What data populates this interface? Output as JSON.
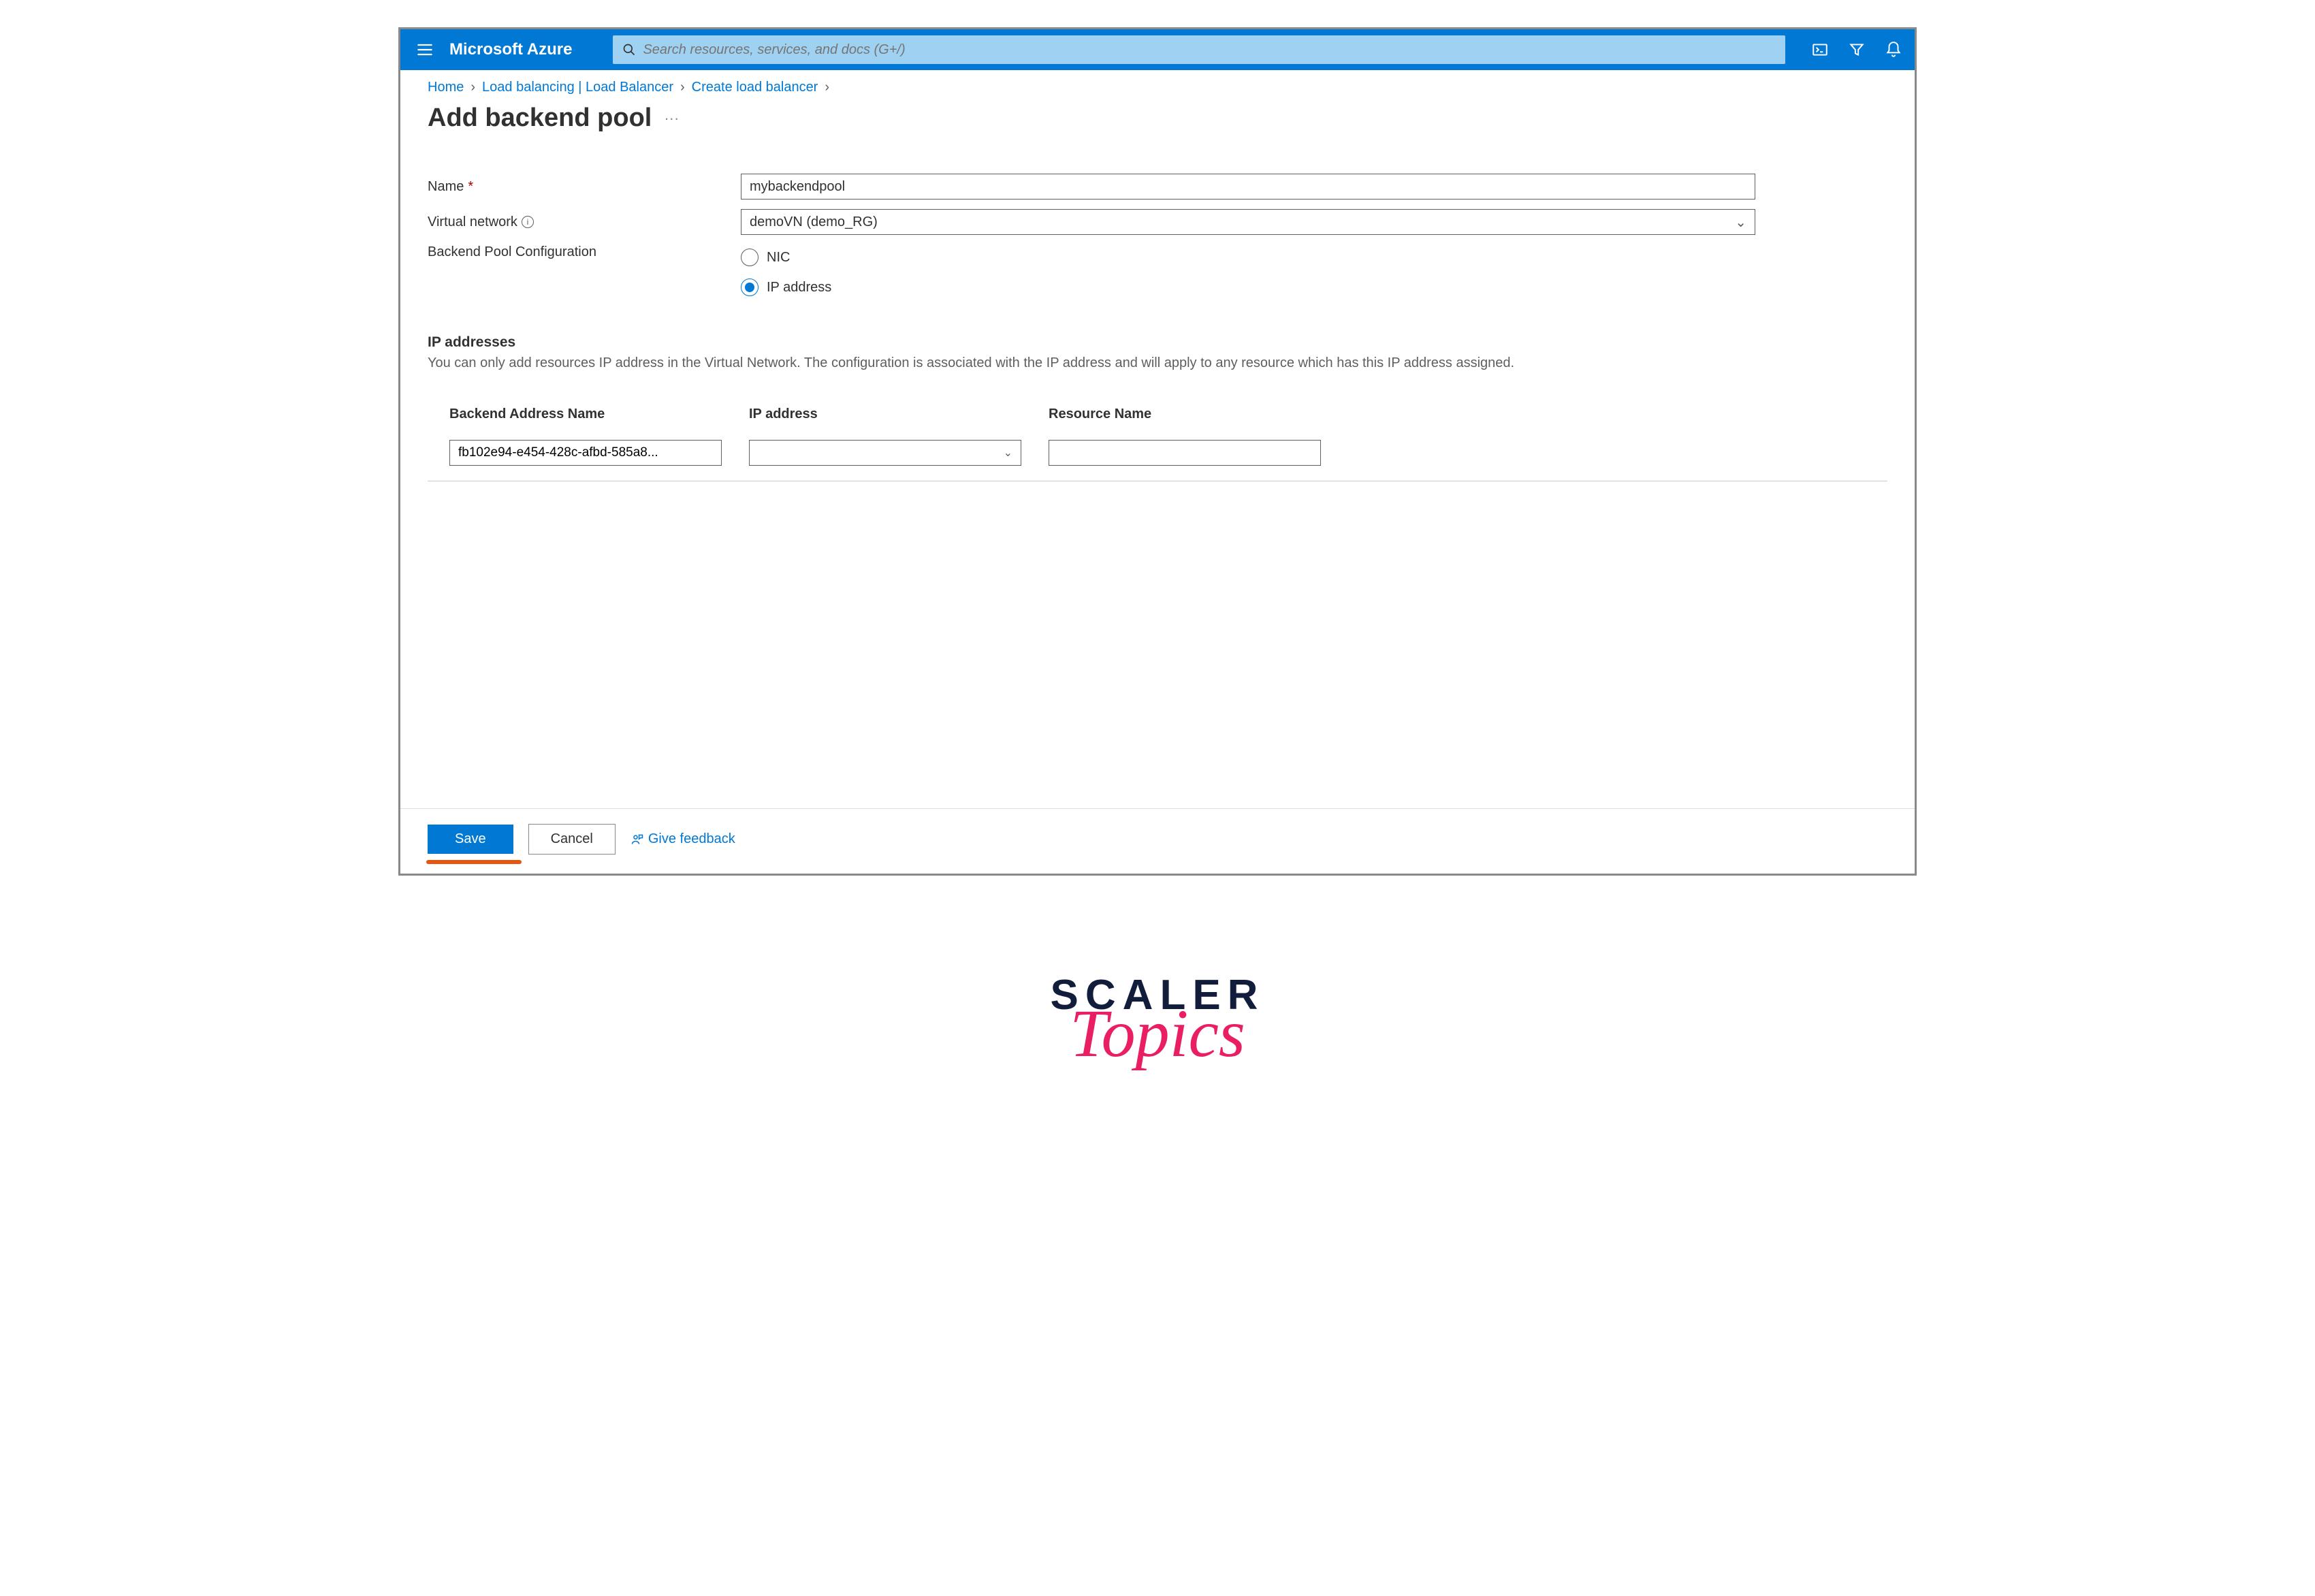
{
  "header": {
    "brand": "Microsoft Azure",
    "search_placeholder": "Search resources, services, and docs (G+/)"
  },
  "breadcrumbs": {
    "home": "Home",
    "lb_list": "Load balancing | Load Balancer",
    "create": "Create load balancer"
  },
  "page": {
    "title": "Add backend pool"
  },
  "form": {
    "name_label": "Name",
    "name_value": "mybackendpool",
    "vnet_label": "Virtual network",
    "vnet_value": "demoVN (demo_RG)",
    "config_label": "Backend Pool Configuration",
    "radio_nic": "NIC",
    "radio_ip": "IP address"
  },
  "ip_section": {
    "title": "IP addresses",
    "desc": "You can only add resources IP address in the Virtual Network. The configuration is associated with the IP address and will apply to any resource which has this IP address assigned.",
    "col_name": "Backend Address Name",
    "col_ip": "IP address",
    "col_res": "Resource Name",
    "row1_name": "fb102e94-e454-428c-afbd-585a8..."
  },
  "footer": {
    "save": "Save",
    "cancel": "Cancel",
    "feedback": "Give feedback"
  },
  "branding": {
    "line1": "SCALER",
    "line2": "Topics"
  }
}
